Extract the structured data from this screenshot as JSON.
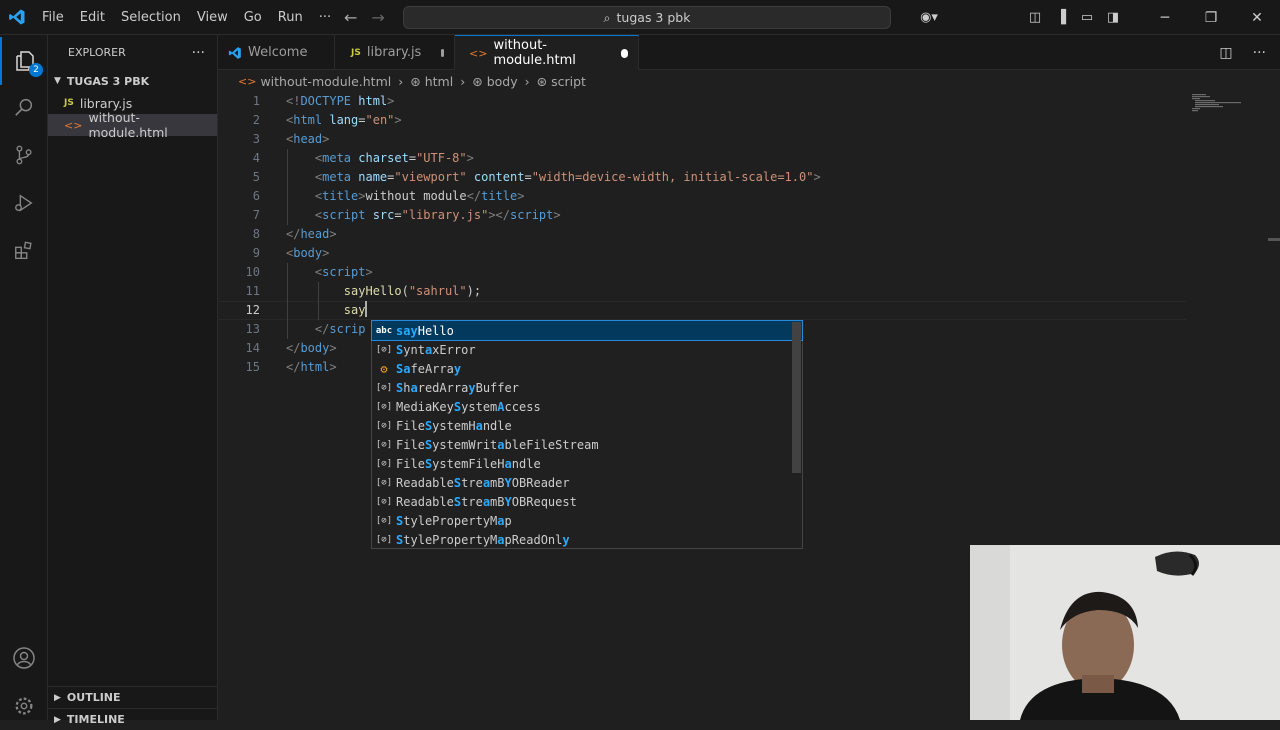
{
  "menu": [
    "File",
    "Edit",
    "Selection",
    "View",
    "Go",
    "Run",
    "···"
  ],
  "search": {
    "text": "tugas 3 pbk"
  },
  "activity_bar": {
    "explorer_badge": "2"
  },
  "sidebar": {
    "title": "EXPLORER",
    "folder": "TUGAS 3 PBK",
    "files": [
      {
        "icon": "JS",
        "name": "library.js"
      },
      {
        "icon": "<>",
        "name": "without-module.html"
      }
    ],
    "outline": "OUTLINE",
    "timeline": "TIMELINE"
  },
  "tabs": [
    {
      "name": "Welcome"
    },
    {
      "icon": "JS",
      "name": "library.js"
    },
    {
      "icon": "<>",
      "name": "without-module.html"
    }
  ],
  "breadcrumb": [
    "without-module.html",
    "html",
    "body",
    "script"
  ],
  "editor": {
    "line_numbers": [
      "1",
      "2",
      "3",
      "4",
      "5",
      "6",
      "7",
      "8",
      "9",
      "10",
      "11",
      "12",
      "13",
      "14",
      "15"
    ],
    "current_line": "12",
    "lines": [
      [
        [
          "<!",
          "t-punc"
        ],
        [
          "DOCTYPE ",
          "t-doc"
        ],
        [
          "html",
          "t-attr"
        ],
        [
          ">",
          "t-punc"
        ]
      ],
      [
        [
          "<",
          "t-punc"
        ],
        [
          "html ",
          "t-tag"
        ],
        [
          "lang",
          "t-attr"
        ],
        [
          "=",
          "t-text"
        ],
        [
          "\"en\"",
          "t-str"
        ],
        [
          ">",
          "t-punc"
        ]
      ],
      [
        [
          "<",
          "t-punc"
        ],
        [
          "head",
          "t-tag"
        ],
        [
          ">",
          "t-punc"
        ]
      ],
      [
        [
          "    <",
          "t-punc"
        ],
        [
          "meta ",
          "t-tag"
        ],
        [
          "charset",
          "t-attr"
        ],
        [
          "=",
          "t-text"
        ],
        [
          "\"UTF-8\"",
          "t-str"
        ],
        [
          ">",
          "t-punc"
        ]
      ],
      [
        [
          "    <",
          "t-punc"
        ],
        [
          "meta ",
          "t-tag"
        ],
        [
          "name",
          "t-attr"
        ],
        [
          "=",
          "t-text"
        ],
        [
          "\"viewport\" ",
          "t-str"
        ],
        [
          "content",
          "t-attr"
        ],
        [
          "=",
          "t-text"
        ],
        [
          "\"width=device-width, initial-scale=1.0\"",
          "t-str"
        ],
        [
          ">",
          "t-punc"
        ]
      ],
      [
        [
          "    <",
          "t-punc"
        ],
        [
          "title",
          "t-tag"
        ],
        [
          ">",
          "t-punc"
        ],
        [
          "without module",
          "t-text"
        ],
        [
          "</",
          "t-punc"
        ],
        [
          "title",
          "t-tag"
        ],
        [
          ">",
          "t-punc"
        ]
      ],
      [
        [
          "    <",
          "t-punc"
        ],
        [
          "script ",
          "t-tag"
        ],
        [
          "src",
          "t-attr"
        ],
        [
          "=",
          "t-text"
        ],
        [
          "\"library.js\"",
          "t-str"
        ],
        [
          "></",
          "t-punc"
        ],
        [
          "script",
          "t-tag"
        ],
        [
          ">",
          "t-punc"
        ]
      ],
      [
        [
          "</",
          "t-punc"
        ],
        [
          "head",
          "t-tag"
        ],
        [
          ">",
          "t-punc"
        ]
      ],
      [
        [
          "<",
          "t-punc"
        ],
        [
          "body",
          "t-tag"
        ],
        [
          ">",
          "t-punc"
        ]
      ],
      [
        [
          "    <",
          "t-punc"
        ],
        [
          "script",
          "t-tag"
        ],
        [
          ">",
          "t-punc"
        ]
      ],
      [
        [
          "        ",
          "t-text"
        ],
        [
          "sayHello",
          "t-fn"
        ],
        [
          "(",
          "t-text"
        ],
        [
          "\"sahrul\"",
          "t-str"
        ],
        [
          ");",
          "t-text"
        ]
      ],
      [
        [
          "        ",
          "t-text"
        ],
        [
          "say",
          "t-fn"
        ]
      ],
      [
        [
          "    </",
          "t-punc"
        ],
        [
          "scrip",
          "t-tag"
        ]
      ],
      [
        [
          "</",
          "t-punc"
        ],
        [
          "body",
          "t-tag"
        ],
        [
          ">",
          "t-punc"
        ]
      ],
      [
        [
          "</",
          "t-punc"
        ],
        [
          "html",
          "t-tag"
        ],
        [
          ">",
          "t-punc"
        ]
      ]
    ]
  },
  "suggestions": [
    {
      "icon": "abc",
      "label": "sayHello"
    },
    {
      "icon": "var",
      "label": "SyntaxError"
    },
    {
      "icon": "class",
      "label": "SafeArray"
    },
    {
      "icon": "var",
      "label": "SharedArrayBuffer"
    },
    {
      "icon": "var",
      "label": "MediaKeySystemAccess"
    },
    {
      "icon": "var",
      "label": "FileSystemHandle"
    },
    {
      "icon": "var",
      "label": "FileSystemWritableFileStream"
    },
    {
      "icon": "var",
      "label": "FileSystemFileHandle"
    },
    {
      "icon": "var",
      "label": "ReadableStreamBYOBReader"
    },
    {
      "icon": "var",
      "label": "ReadableStreamBYOBRequest"
    },
    {
      "icon": "var",
      "label": "StylePropertyMap"
    },
    {
      "icon": "var",
      "label": "StylePropertyMapReadOnly"
    }
  ],
  "suggest_match": "say",
  "colors": {
    "accent": "#0078d4",
    "selection": "#04395e",
    "editor_bg": "#1f1f1f",
    "highlight": "#2aaaff"
  }
}
